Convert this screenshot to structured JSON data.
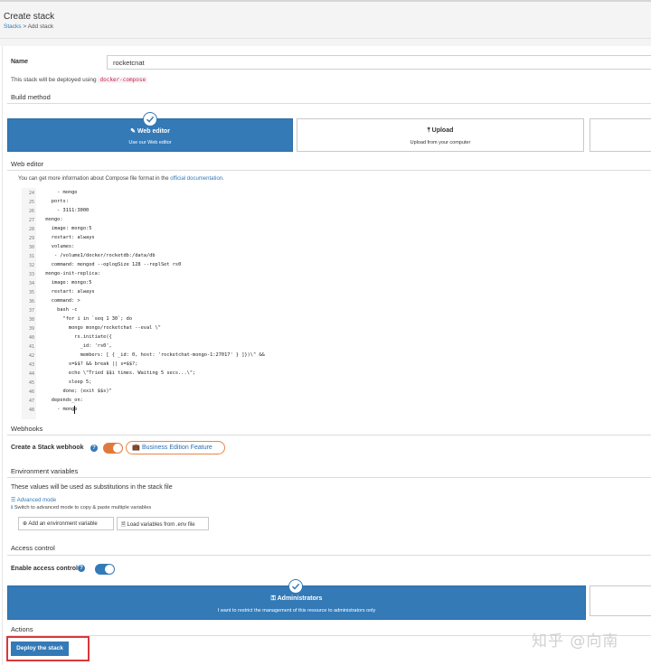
{
  "header": {
    "title": "Create stack",
    "crumb_link": "Stacks",
    "crumb_sep": " > ",
    "crumb_current": "Add stack"
  },
  "name": {
    "label": "Name",
    "value": "rocketcnat",
    "deploy_note_prefix": "This stack will be deployed using",
    "deploy_tool": "docker-compose"
  },
  "build_method": {
    "title": "Build method",
    "web_editor": {
      "title": "Web editor",
      "subtitle": "Use our Web editor",
      "icon": "edit-icon"
    },
    "upload": {
      "title": "Upload",
      "subtitle": "Upload from your computer",
      "icon": "upload-icon"
    }
  },
  "web_editor": {
    "title": "Web editor",
    "hint_prefix": "You can get more information about Compose file format in the ",
    "hint_link": "official documentation",
    "hint_suffix": ".",
    "lines": [
      {
        "n": "24",
        "code": "      - mongo"
      },
      {
        "n": "25",
        "code": "    ports:"
      },
      {
        "n": "26",
        "code": "      - 3111:3000"
      },
      {
        "n": "27",
        "code": "  mongo:"
      },
      {
        "n": "28",
        "code": "    image: mongo:5"
      },
      {
        "n": "29",
        "code": "    restart: always"
      },
      {
        "n": "30",
        "code": "    volumes:"
      },
      {
        "n": "31",
        "code": "     - /volume1/docker/rocketdb:/data/db"
      },
      {
        "n": "32",
        "code": "    command: mongod --oplogSize 128 --replSet rs0"
      },
      {
        "n": "33",
        "code": "  mongo-init-replica:"
      },
      {
        "n": "34",
        "code": "    image: mongo:5"
      },
      {
        "n": "35",
        "code": "    restart: always"
      },
      {
        "n": "36",
        "code": "    command: >"
      },
      {
        "n": "37",
        "code": "      bash -c"
      },
      {
        "n": "38",
        "code": "        \"for i in `seq 1 30`; do"
      },
      {
        "n": "39",
        "code": "          mongo mongo/rocketchat --eval \\\""
      },
      {
        "n": "40",
        "code": "            rs.initiate({"
      },
      {
        "n": "41",
        "code": "              _id: 'rs0',"
      },
      {
        "n": "42",
        "code": "              members: [ { _id: 0, host: 'rocketchat-mongo-1:27017' } ]})\\\" &&"
      },
      {
        "n": "43",
        "code": "          s=$$? && break || s=$$?;"
      },
      {
        "n": "44",
        "code": "          echo \\\"Tried $$i times. Waiting 5 secs...\\\";"
      },
      {
        "n": "45",
        "code": "          sleep 5;"
      },
      {
        "n": "46",
        "code": "        done; (exit $$s)\""
      },
      {
        "n": "47",
        "code": "    depends_on:"
      },
      {
        "n": "48",
        "code": "      - mongo"
      }
    ]
  },
  "webhooks": {
    "title": "Webhooks",
    "label": "Create a Stack webhook",
    "toggle_on": true,
    "business_button": "Business Edition Feature"
  },
  "env": {
    "title": "Environment variables",
    "desc": "These values will be used as substitutions in the stack file",
    "advanced_link": "Advanced mode",
    "advanced_hint": "Switch to advanced mode to copy & paste multiple variables",
    "add_button": "Add an environment variable",
    "load_button": "Load variables from .env file"
  },
  "access": {
    "title": "Access control",
    "label": "Enable access control",
    "toggle_on": true,
    "admin_title": "Administrators",
    "admin_subtitle": "I want to restrict the management of this resource to administrators only"
  },
  "actions": {
    "title": "Actions",
    "deploy_button": "Deploy the stack"
  },
  "watermark": "知乎 @向南",
  "colors": {
    "primary": "#337ab7",
    "toggle_orange": "#e07a3a",
    "highlight_red": "#d9383a"
  }
}
